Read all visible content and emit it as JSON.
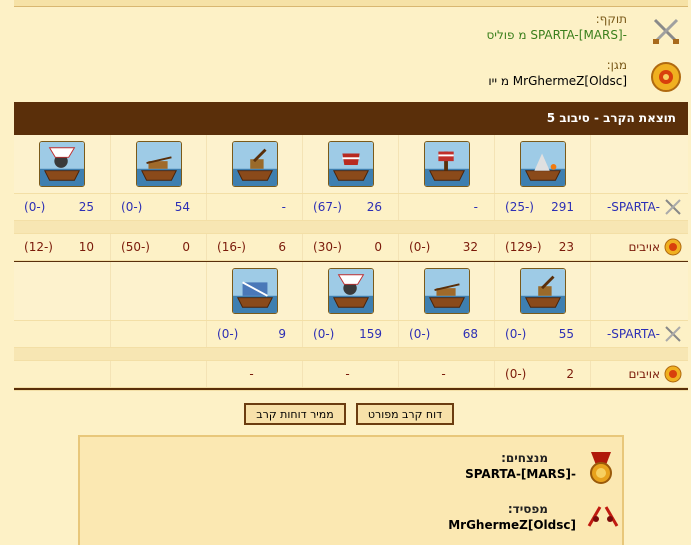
{
  "top_strip_text": "",
  "attacker": {
    "label": "תוקף:",
    "name": "-SPARTA-[MARS] מ פוליס"
  },
  "defender": {
    "label": "מגן:",
    "name": "MrGhermeZ[Oldsc] מ ייו"
  },
  "battle_header": "תוצאת הקרב - סיבוב 5",
  "section1": {
    "units": [
      "fire-ship",
      "ram-ship",
      "flame-ship",
      "catapult-ship",
      "ballista-ship",
      "mortar-ship"
    ],
    "sparta": {
      "name": "-SPARTA-",
      "cells": [
        [
          "291",
          "(-25)"
        ],
        [
          "-",
          ""
        ],
        [
          "26",
          "(-67)"
        ],
        [
          "-",
          ""
        ],
        [
          "54",
          "(-0)"
        ],
        [
          "25",
          "(-0)"
        ]
      ]
    },
    "enemy": {
      "name": "אויבים",
      "cells": [
        [
          "23",
          "(-129)"
        ],
        [
          "32",
          "(-0)"
        ],
        [
          "0",
          "(-30)"
        ],
        [
          "6",
          "(-16)"
        ],
        [
          "0",
          "(-50)"
        ],
        [
          "10",
          "(-12)"
        ]
      ]
    }
  },
  "section2": {
    "units": [
      "catapult-ship",
      "ballista-ship",
      "mortar-ship",
      "steam-ram"
    ],
    "sparta": {
      "name": "-SPARTA-",
      "cells": [
        [
          "55",
          "(-0)"
        ],
        [
          "68",
          "(-0)"
        ],
        [
          "159",
          "(-0)"
        ],
        [
          "9",
          "(-0)"
        ],
        [
          "",
          ""
        ],
        [
          "",
          ""
        ]
      ]
    },
    "enemy": {
      "name": "אויבים",
      "cells": [
        [
          "2",
          "(-0)"
        ],
        [
          "-",
          ""
        ],
        [
          "-",
          ""
        ],
        [
          "-",
          ""
        ],
        [
          "",
          ""
        ],
        [
          "",
          ""
        ]
      ]
    }
  },
  "buttons": {
    "detailed": "דוח קרב מפורט",
    "converter": "ממיר דוחות קרב"
  },
  "result": {
    "winners_label": "מנצחים:",
    "winners": "-SPARTA-[MARS]",
    "loser_label": "מפסיד:",
    "loser": "MrGhermeZ[Oldsc]"
  },
  "colors": {
    "header_bg": "#5a2f0a",
    "page_bg": "#fdf1c6",
    "blue_text": "#2d2fb5",
    "red_text": "#7a1a0a",
    "green_text": "#3a7f1c"
  }
}
